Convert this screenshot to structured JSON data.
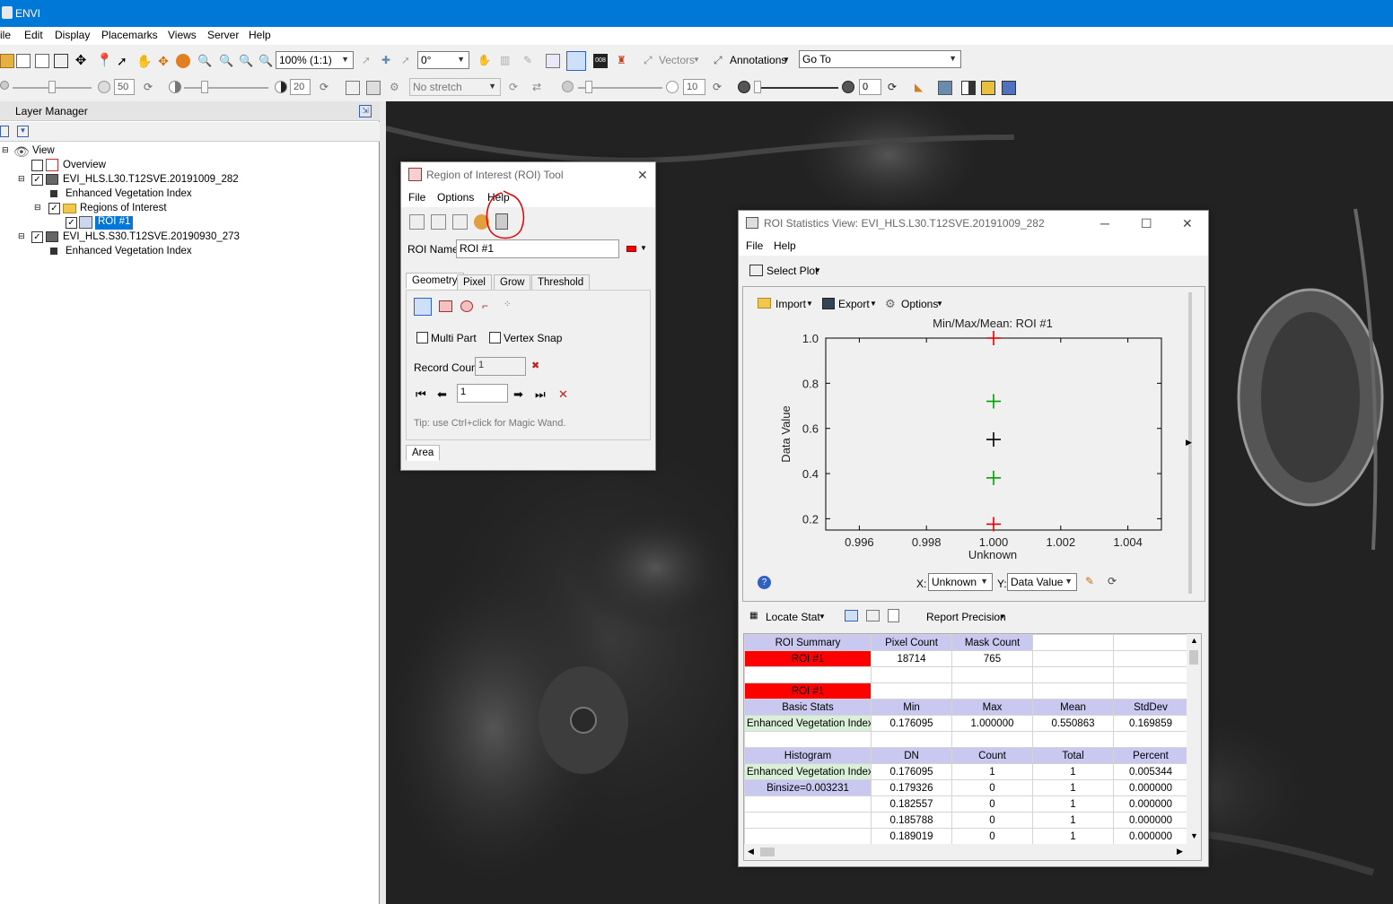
{
  "app": {
    "title": "ENVI"
  },
  "menu": [
    "ile",
    "Edit",
    "Display",
    "Placemarks",
    "Views",
    "Server",
    "Help"
  ],
  "toolbar": {
    "zoom": "100% (1:1)",
    "rotation": "0°",
    "vectors": "Vectors",
    "annotations": "Annotations",
    "goto": "Go To",
    "brightness": "50",
    "contrast": "20",
    "stretch": "No stretch",
    "sharpen": "10",
    "transparency": "0"
  },
  "layer_manager": {
    "title": "Layer Manager",
    "items": [
      "View",
      "Overview",
      "EVI_HLS.L30.T12SVE.20191009_282",
      "Enhanced Vegetation Index",
      "Regions of Interest",
      "ROI #1",
      "EVI_HLS.S30.T12SVE.20190930_273",
      "Enhanced Vegetation Index"
    ],
    "checked": [
      false,
      true,
      true,
      true,
      true
    ]
  },
  "roi_tool": {
    "title": "Region of Interest (ROI) Tool",
    "menu": [
      "File",
      "Options",
      "Help"
    ],
    "name_label": "ROI Name:",
    "name_value": "ROI #1",
    "tabs": [
      "Geometry",
      "Pixel",
      "Grow",
      "Threshold"
    ],
    "multipart": "Multi Part",
    "vertex_snap": "Vertex Snap",
    "record_count_label": "Record Count",
    "record_count": "1",
    "nav_value": "1",
    "tip": "Tip: use Ctrl+click for Magic Wand.",
    "bottom_tab": "Area",
    "colors": {
      "roi": "#ff0000"
    }
  },
  "stats_view": {
    "title": "ROI Statistics View: EVI_HLS.L30.T12SVE.20191009_282",
    "menu": [
      "File",
      "Help"
    ],
    "select_plot": "Select Plot",
    "import": "Import",
    "export": "Export",
    "options": "Options",
    "x_label": "X:",
    "x_value": "Unknown",
    "y_label": "Y:",
    "y_value": "Data Value",
    "locate_stat": "Locate Stat",
    "report_precision": "Report Precision",
    "table": {
      "summary_headers": [
        "ROI Summary",
        "Pixel Count",
        "Mask Count",
        "",
        ""
      ],
      "summary_row": [
        "ROI #1",
        "18714",
        "765",
        "",
        ""
      ],
      "roi_label": "ROI #1",
      "basic_headers": [
        "Basic Stats",
        "Min",
        "Max",
        "Mean",
        "StdDev"
      ],
      "basic_row": [
        "Enhanced Vegetation Index",
        "0.176095",
        "1.000000",
        "0.550863",
        "0.169859"
      ],
      "hist_headers": [
        "Histogram",
        "DN",
        "Count",
        "Total",
        "Percent"
      ],
      "hist_rows": [
        [
          "Enhanced Vegetation Index",
          "0.176095",
          "1",
          "1",
          "0.005344"
        ],
        [
          "Binsize=0.003231",
          "0.179326",
          "0",
          "1",
          "0.000000"
        ],
        [
          "",
          "0.182557",
          "0",
          "1",
          "0.000000"
        ],
        [
          "",
          "0.185788",
          "0",
          "1",
          "0.000000"
        ],
        [
          "",
          "0.189019",
          "0",
          "1",
          "0.000000"
        ]
      ]
    }
  },
  "chart_data": {
    "type": "scatter",
    "title": "Min/Max/Mean: ROI #1",
    "xlabel": "Unknown",
    "ylabel": "Data Value",
    "xlim": [
      0.995,
      1.005
    ],
    "ylim": [
      0.15,
      1.0
    ],
    "xticks": [
      "0.996",
      "0.998",
      "1.000",
      "1.002",
      "1.004"
    ],
    "yticks": [
      "1.0",
      "0.8",
      "0.6",
      "0.4",
      "0.2"
    ],
    "points": [
      {
        "x": 1.0,
        "y": 1.0,
        "color": "#e00000"
      },
      {
        "x": 1.0,
        "y": 0.72,
        "color": "#00a000"
      },
      {
        "x": 1.0,
        "y": 0.551,
        "color": "#000000"
      },
      {
        "x": 1.0,
        "y": 0.381,
        "color": "#00a000"
      },
      {
        "x": 1.0,
        "y": 0.176,
        "color": "#e00000"
      }
    ]
  }
}
